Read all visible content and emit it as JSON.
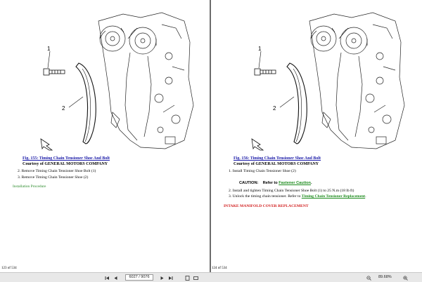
{
  "left_page": {
    "callout_1": "1",
    "callout_2": "2",
    "caption": "Fig. 155: Timing Chain Tensioner Shoe And Bolt",
    "courtesy": "Courtesy of GENERAL MOTORS COMPANY",
    "steps": [
      "2. Remove Timing Chain Tensioner Shoe Bolt (1)",
      "3. Remove Timing Chain Tensioner Shoe (2)"
    ],
    "installation_link": "Installation Procedure",
    "page_number": "123 of 534"
  },
  "right_page": {
    "callout_1": "1",
    "callout_2": "2",
    "caption": "Fig. 156: Timing Chain Tensioner Shoe And Bolt",
    "courtesy": "Courtesy of GENERAL MOTORS COMPANY",
    "step_1": "1. Install Timing Chain Tensioner Shoe (2)",
    "caution_label": "CAUTION:",
    "caution_refer": "Refer to",
    "caution_link": "Fastener Caution",
    "caution_end": ".",
    "step_2": "2. Install and tighten Timing Chain Tensioner Shoe Bolt (1) to 25 N.m (18 lb ft)",
    "step_3_text": "3. Unlock the timing chain tensioner. Refer to",
    "step_3_link": "Timing Chain Tensioner Replacement",
    "step_3_end": ".",
    "section_heading": "INTAKE MANIFOLD COVER REPLACEMENT",
    "page_number": "124 of 534"
  },
  "toolbar": {
    "page_input": "6027 / 9076",
    "zoom": "89.68%",
    "icons": [
      "first-page-icon",
      "previous-page-icon",
      "next-page-icon",
      "last-page-icon",
      "fit-page-icon",
      "fit-width-icon",
      "zoom-out-icon",
      "zoom-in-icon"
    ]
  }
}
